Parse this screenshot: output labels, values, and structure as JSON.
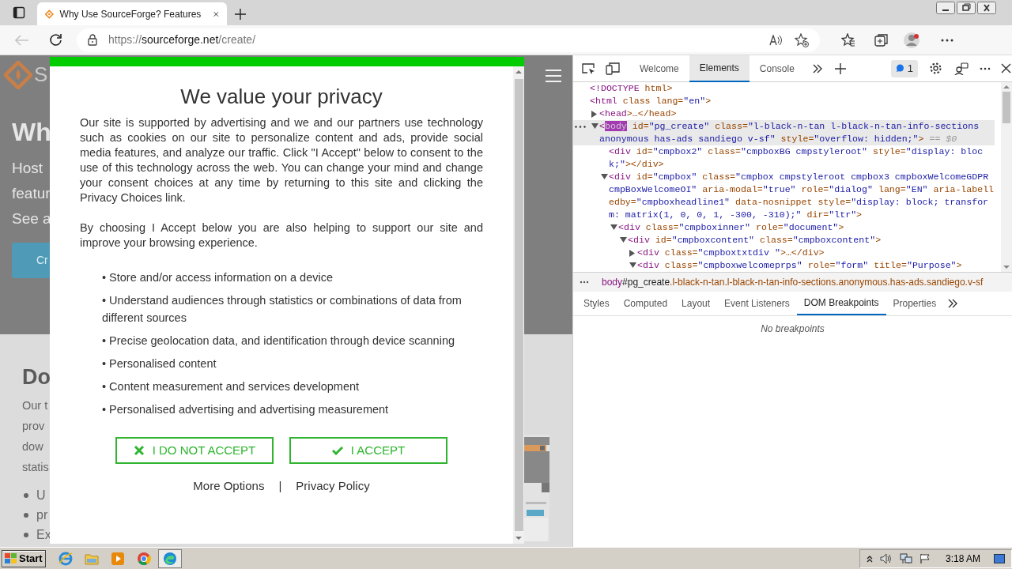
{
  "browser": {
    "tab_title": "Why Use SourceForge? Features",
    "url": {
      "scheme": "https://",
      "host": "sourceforge.net",
      "path": "/create/"
    }
  },
  "page": {
    "logo_text": "S",
    "heading": "Wh",
    "intro_lines": [
      "Host",
      "featur",
      "See a"
    ],
    "button": "Cr",
    "section_heading": "Do",
    "section_lines": [
      "Our t",
      "prov",
      "dow",
      "statis"
    ],
    "bullets": [
      "U",
      "pr",
      "Ex"
    ]
  },
  "consent": {
    "title": "We value your privacy",
    "paragraphs": [
      "Our site is supported by advertising and we and our partners use technology such as cookies on our site to personalize content and ads, provide social media features, and analyze our traffic. Click \"I Accept\" below to consent to the use of this technology across the web. You can change your mind and change your consent choices at any time by returning to this site and clicking the Privacy Choices link.",
      "By choosing I Accept below you are also helping to support our site and improve your browsing experience."
    ],
    "purposes": [
      "• Store and/or access information on a device",
      "• Understand audiences through statistics or combinations of data from different sources",
      "• Precise geolocation data, and identification through device scanning",
      "• Personalised content",
      "• Content measurement and services development",
      "• Personalised advertising and advertising measurement"
    ],
    "buttons": [
      {
        "label": "I DO NOT ACCEPT",
        "kind": "reject"
      },
      {
        "label": "I ACCEPT",
        "kind": "accept"
      }
    ],
    "links": [
      "More Options",
      "Privacy Policy"
    ],
    "separator": "|"
  },
  "devtools": {
    "tabs": [
      {
        "label": "Welcome",
        "selected": false
      },
      {
        "label": "Elements",
        "selected": true
      },
      {
        "label": "Console",
        "selected": false
      }
    ],
    "issues_count": "1",
    "dom": [
      {
        "open": "<!",
        "tag": "DOCTYPE",
        "rest": " html>",
        "selected": false
      },
      {
        "open": "<",
        "tag": "html",
        "rest": " class lang=\"en\">",
        "selected": false,
        "children": [
          {
            "open": "<",
            "tag": "head",
            "rest": ">…</head>",
            "selected": false,
            "expanded": false
          },
          {
            "open": "<",
            "tag": "body",
            "rest": " id=\"pg_create\" class=\"l-black-n-tan l-black-n-tan-info-sections  anonymous has-ads sandiego v-sf\" style=\"overflow: hidden;\">",
            "marker": "== $0",
            "selected": true,
            "expanded": true,
            "children": [
              {
                "open": "<",
                "tag": "div",
                "rest": " id=\"cmpbox2\" class=\"cmpboxBG cmpstyleroot\" style=\"display: block;\"></div>",
                "selected": false
              },
              {
                "open": "<",
                "tag": "div",
                "rest": " id=\"cmpbox\" class=\"cmpbox cmpstyleroot cmpbox3 cmpboxWelcomeGDPR cmpBoxWelcomeOI\" aria-modal=\"true\" role=\"dialog\" lang=\"EN\" aria-labelledby=\"cmpboxheadline1\" data-nosnippet style=\"display: block; transform: matrix(1, 0, 0, 1, -300, -310);\" dir=\"ltr\">",
                "selected": false,
                "expanded": true,
                "children": [
                  {
                    "open": "<",
                    "tag": "div",
                    "rest": " class=\"cmpboxinner\" role=\"document\">",
                    "selected": false,
                    "expanded": true,
                    "children": [
                      {
                        "open": "<",
                        "tag": "div",
                        "rest": " id=\"cmpboxcontent\" class=\"cmpboxcontent\">",
                        "selected": false,
                        "expanded": true,
                        "children": [
                          {
                            "open": "<",
                            "tag": "div",
                            "rest": " class=\"cmpboxtxtdiv \">…</div>",
                            "selected": false,
                            "expanded": false
                          },
                          {
                            "open": "<",
                            "tag": "div",
                            "rest": " class=\"cmpboxwelcomeprps\" role=\"form\" title=\"Purpose\">",
                            "selected": false,
                            "expanded": true
                          }
                        ]
                      }
                    ]
                  }
                ]
              }
            ]
          }
        ]
      }
    ],
    "breadcrumb": {
      "tag": "body",
      "id": "#pg_create",
      "classes": ".l-black-n-tan.l-black-n-tan-info-sections.anonymous.has-ads.sandiego.v-sf"
    },
    "subtabs": [
      {
        "label": "Styles",
        "selected": false
      },
      {
        "label": "Computed",
        "selected": false
      },
      {
        "label": "Layout",
        "selected": false
      },
      {
        "label": "Event Listeners",
        "selected": false
      },
      {
        "label": "DOM Breakpoints",
        "selected": true
      },
      {
        "label": "Properties",
        "selected": false
      }
    ],
    "empty_message": "No breakpoints"
  },
  "taskbar": {
    "start": "Start",
    "clock": "3:18 AM"
  }
}
